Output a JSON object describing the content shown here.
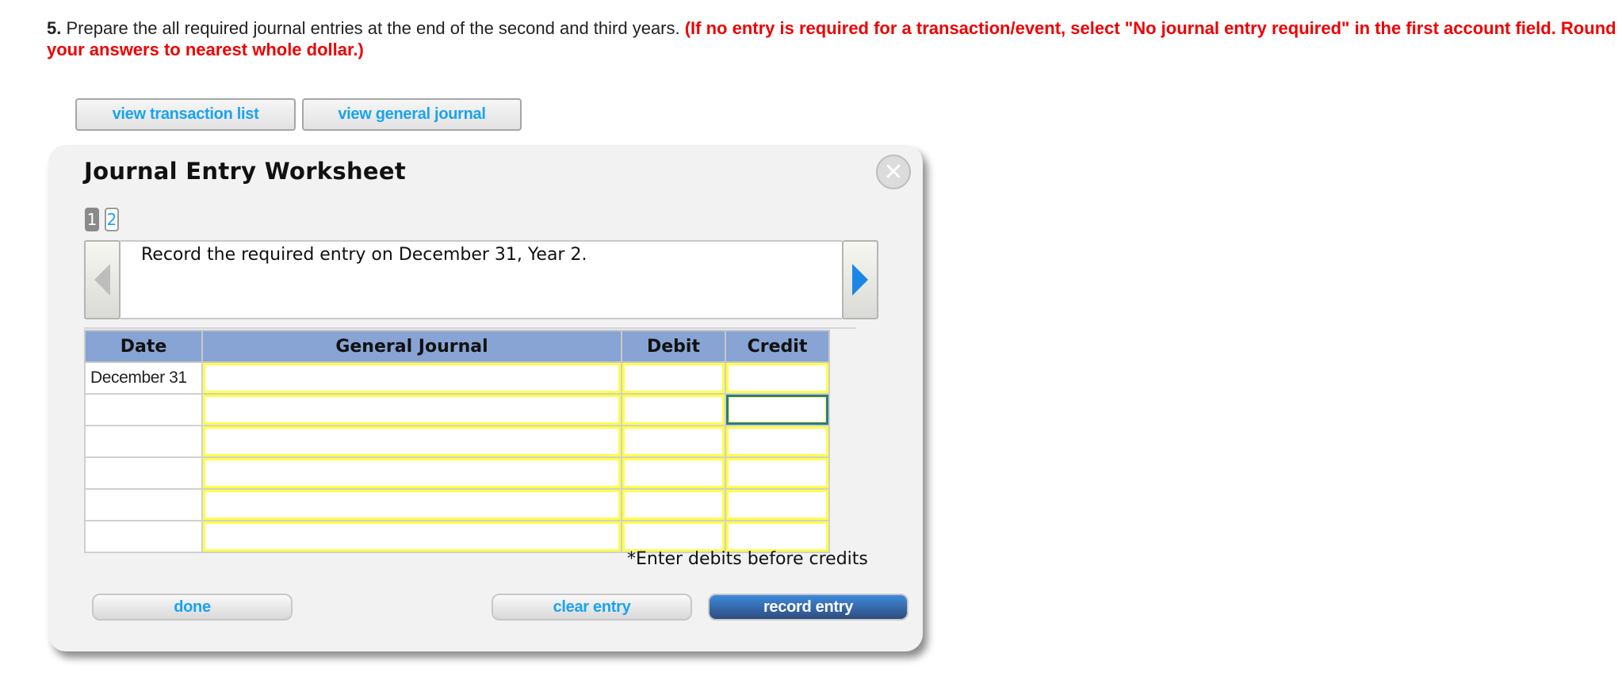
{
  "question": {
    "number": "5.",
    "text": " Prepare the all required journal entries at the end of the second and third years. ",
    "instruction": "(If no entry is required for a transaction/event, select \"No journal entry required\" in the first account field. Round your answers to nearest whole dollar.)"
  },
  "top_buttons": {
    "transaction_list": "view transaction list",
    "general_journal": "view general journal"
  },
  "worksheet": {
    "title": "Journal Entry Worksheet",
    "close_glyph": "✕",
    "pages": [
      "1",
      "2"
    ],
    "active_page": "1",
    "instruction": "Record the required entry on December 31, Year 2.",
    "table": {
      "headers": [
        "Date",
        "General Journal",
        "Debit",
        "Credit"
      ],
      "rows": [
        {
          "date": "December 31",
          "account": "",
          "debit": "",
          "credit": ""
        },
        {
          "date": "",
          "account": "",
          "debit": "",
          "credit": ""
        },
        {
          "date": "",
          "account": "",
          "debit": "",
          "credit": ""
        },
        {
          "date": "",
          "account": "",
          "debit": "",
          "credit": ""
        },
        {
          "date": "",
          "account": "",
          "debit": "",
          "credit": ""
        },
        {
          "date": "",
          "account": "",
          "debit": "",
          "credit": ""
        }
      ]
    },
    "hint": "*Enter debits before credits",
    "buttons": {
      "done": "done",
      "clear": "clear entry",
      "record": "record entry"
    }
  },
  "colors": {
    "accent_blue": "#1aa3ef",
    "instruction_red": "#ee0000",
    "header_blue": "#87a4d4",
    "input_border_yellow": "#ffff4a",
    "record_button": "#2f4c7c"
  }
}
